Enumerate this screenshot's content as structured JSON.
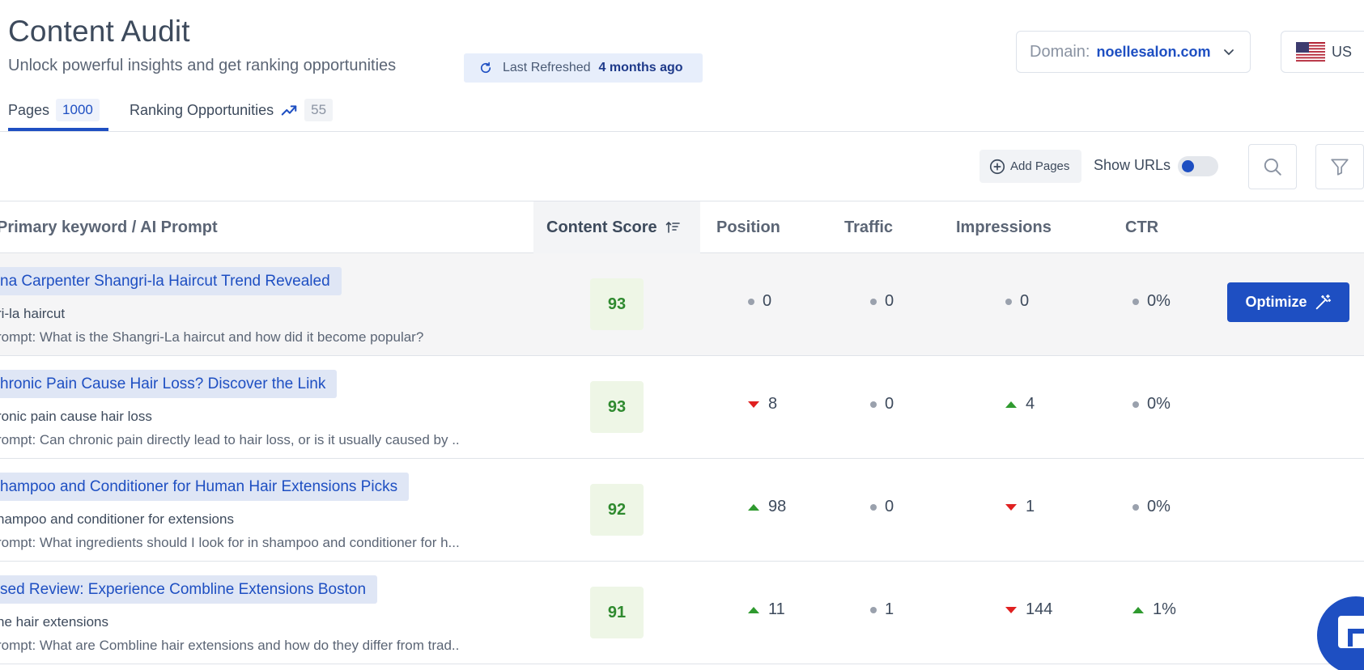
{
  "header": {
    "title": "Content Audit",
    "subtitle": "Unlock powerful insights and get ranking opportunities",
    "refresh_label": "Last Refreshed",
    "refresh_value": "4 months ago"
  },
  "domain_selector": {
    "label": "Domain:",
    "value": "noellesalon.com"
  },
  "country_selector": {
    "value": "US",
    "flag": "us-flag-icon"
  },
  "tabs": [
    {
      "label": "Pages",
      "count": "1000",
      "active": true
    },
    {
      "label": "Ranking Opportunities",
      "count": "55",
      "icon": "trending-up-icon"
    }
  ],
  "toolbar": {
    "add_pages_label": "Add Pages",
    "show_urls_label": "Show URLs",
    "show_urls_on": false
  },
  "table": {
    "columns": [
      "Primary keyword / AI Prompt",
      "Content Score",
      "Position",
      "Traffic",
      "Impressions",
      "CTR"
    ],
    "action_label": "Optimize",
    "rows": [
      {
        "title": "na Carpenter Shangri-la Haircut Trend Revealed",
        "keyword": "ri-la haircut",
        "prompt": "rompt: What is the Shangri-La haircut and how did it become popular?",
        "score": "93",
        "position": {
          "value": "0",
          "trend": "neutral"
        },
        "traffic": {
          "value": "0",
          "trend": "neutral"
        },
        "impressions": {
          "value": "0",
          "trend": "neutral"
        },
        "ctr": {
          "value": "0%",
          "trend": "neutral"
        }
      },
      {
        "title": "hronic Pain Cause Hair Loss? Discover the Link",
        "keyword": "ronic pain cause hair loss",
        "prompt": "rompt: Can chronic pain directly lead to hair loss, or is it usually caused by ..",
        "score": "93",
        "position": {
          "value": "8",
          "trend": "down"
        },
        "traffic": {
          "value": "0",
          "trend": "neutral"
        },
        "impressions": {
          "value": "4",
          "trend": "up"
        },
        "ctr": {
          "value": "0%",
          "trend": "neutral"
        }
      },
      {
        "title": "hampoo and Conditioner for Human Hair Extensions Picks",
        "keyword": "hampoo and conditioner for extensions",
        "prompt": "rompt: What ingredients should I look for in shampoo and conditioner for h...",
        "score": "92",
        "position": {
          "value": "98",
          "trend": "up"
        },
        "traffic": {
          "value": "0",
          "trend": "neutral"
        },
        "impressions": {
          "value": "1",
          "trend": "down"
        },
        "ctr": {
          "value": "0%",
          "trend": "neutral"
        }
      },
      {
        "title": "sed Review: Experience Combline Extensions Boston",
        "keyword": "ne hair extensions",
        "prompt": "rompt: What are Combline hair extensions and how do they differ from trad..",
        "score": "91",
        "position": {
          "value": "11",
          "trend": "up"
        },
        "traffic": {
          "value": "1",
          "trend": "neutral"
        },
        "impressions": {
          "value": "144",
          "trend": "down"
        },
        "ctr": {
          "value": "1%",
          "trend": "up"
        }
      }
    ]
  },
  "colors": {
    "accent": "#1e4fc2",
    "score_bg": "#eef6e6",
    "score_text": "#2f8a2f",
    "trend_up": "#2f9a2f",
    "trend_down": "#e02020"
  }
}
